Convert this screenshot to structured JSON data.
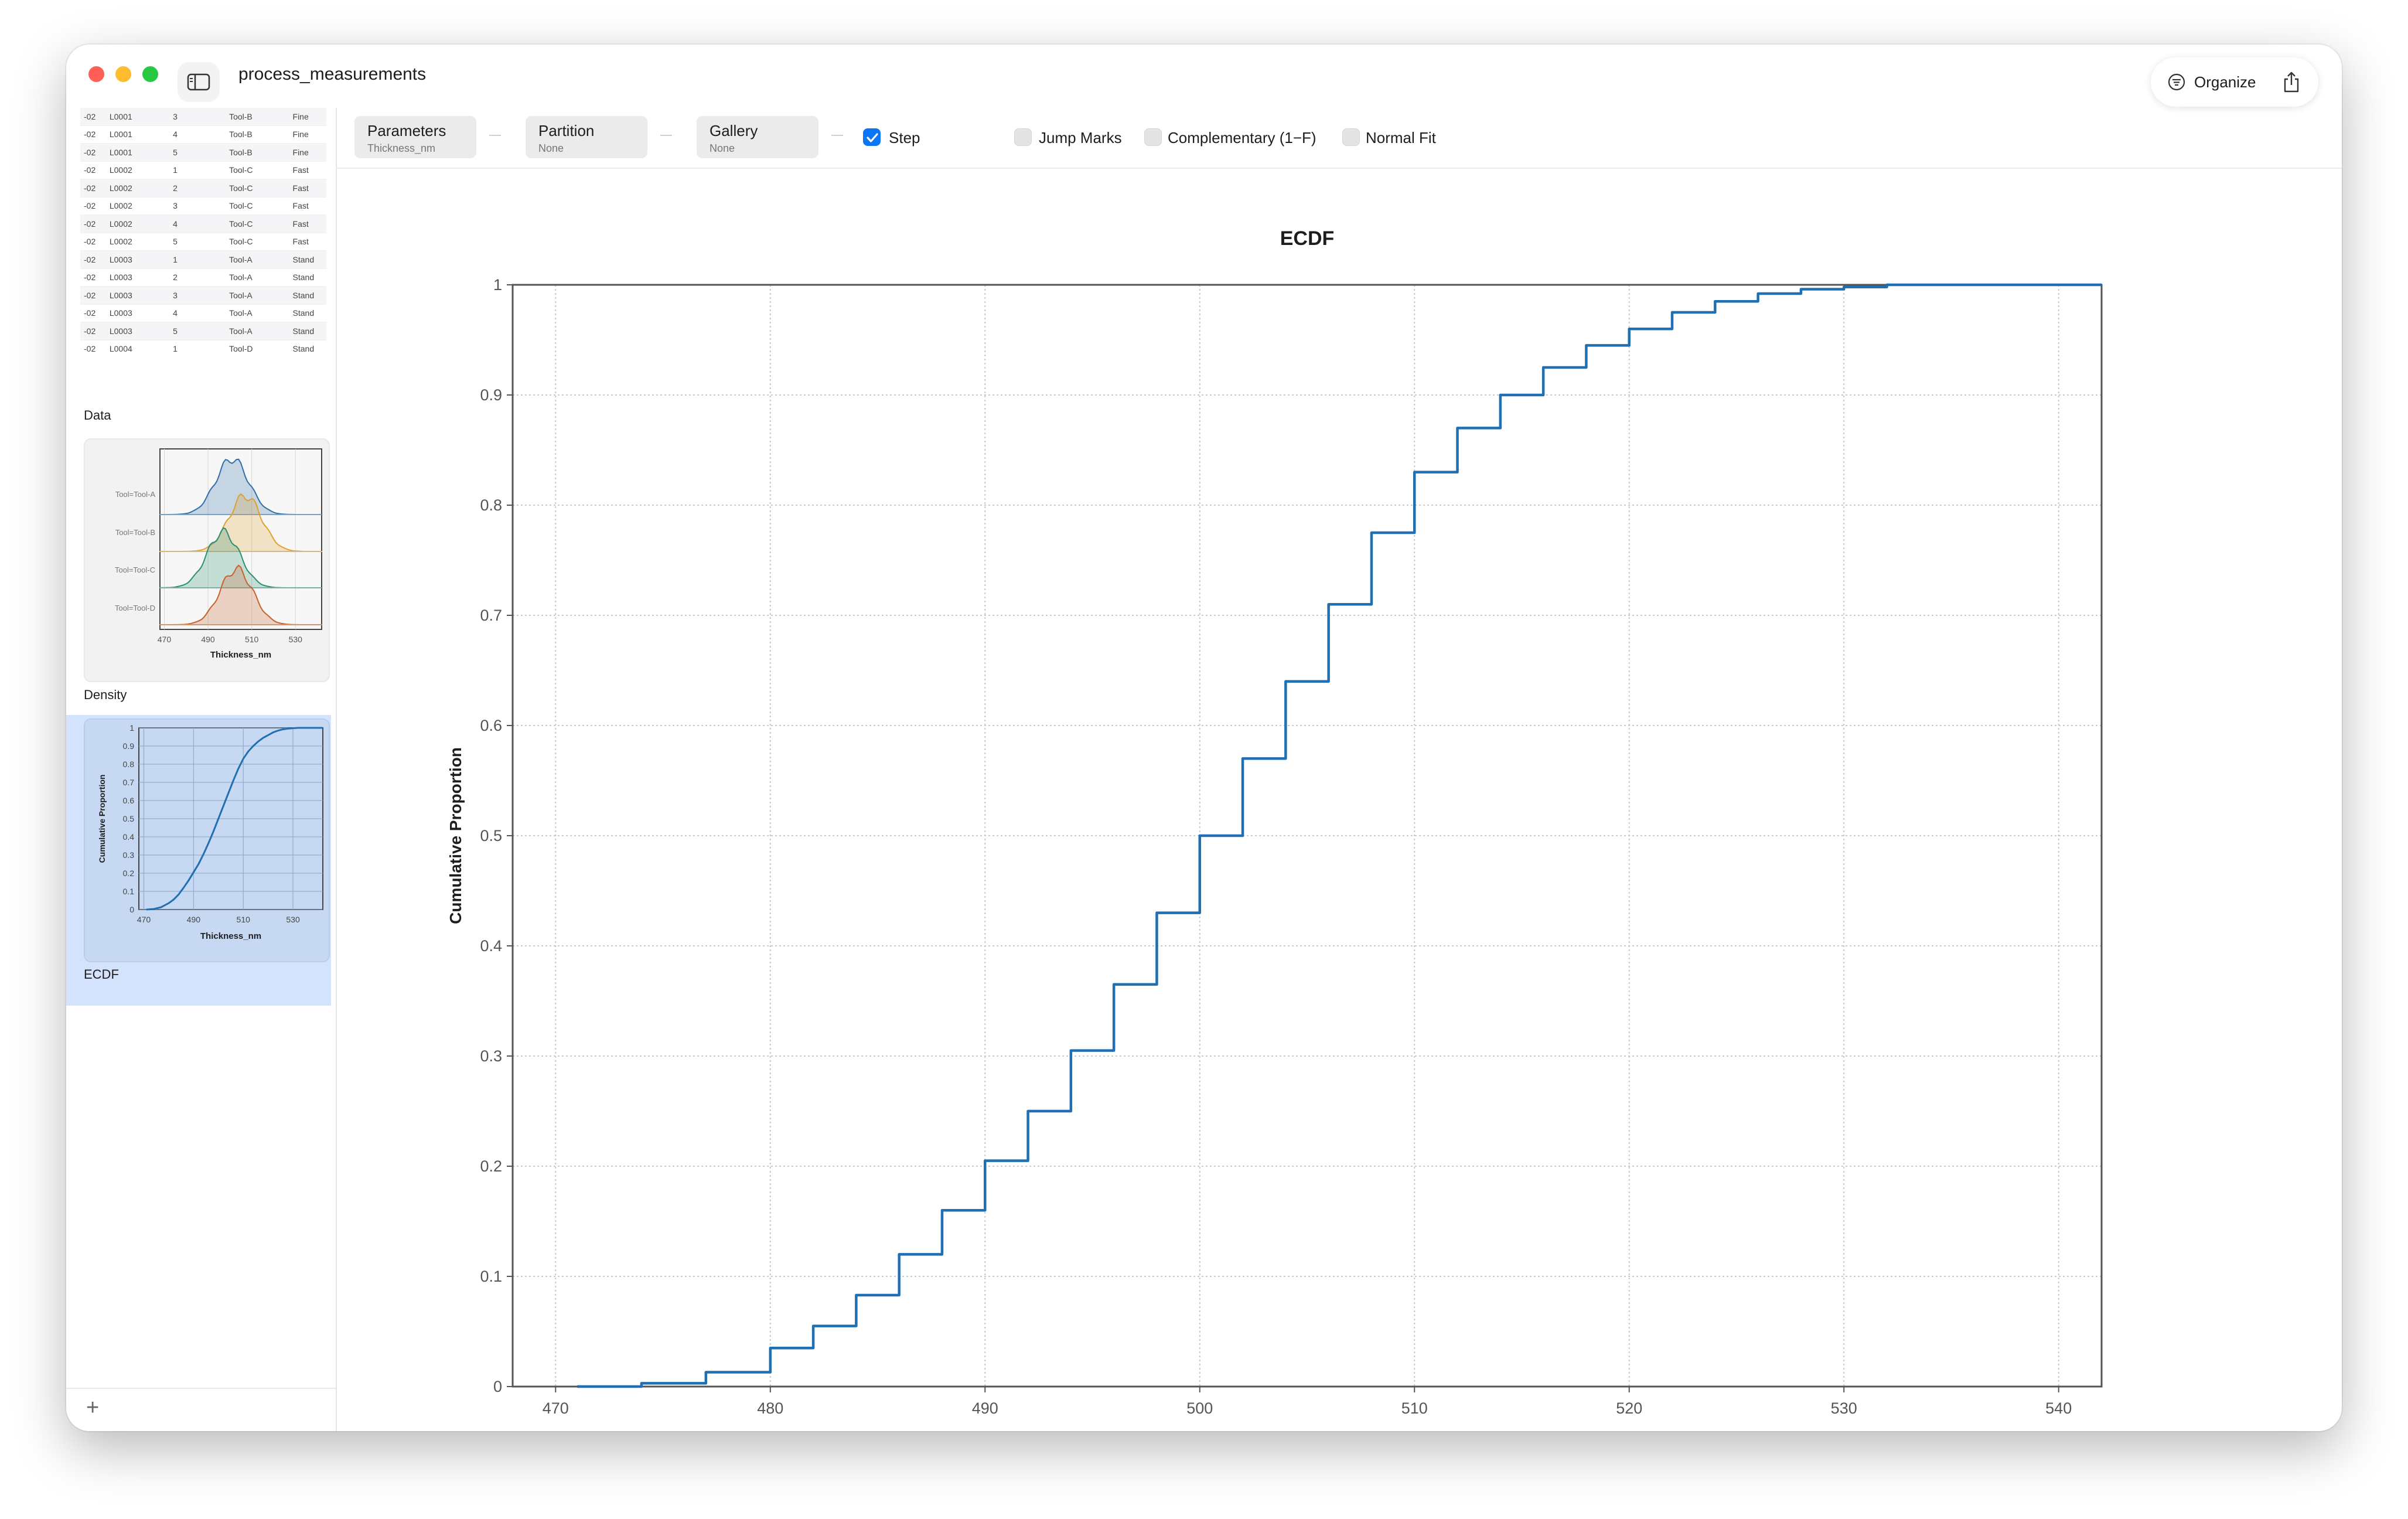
{
  "window": {
    "title": "process_measurements"
  },
  "toolbar_right": {
    "organize_label": "Organize"
  },
  "sidebar": {
    "data_rows": [
      [
        "-02",
        "L0001",
        "3",
        "Tool-B",
        "Fine"
      ],
      [
        "-02",
        "L0001",
        "4",
        "Tool-B",
        "Fine"
      ],
      [
        "-02",
        "L0001",
        "5",
        "Tool-B",
        "Fine"
      ],
      [
        "-02",
        "L0002",
        "1",
        "Tool-C",
        "Fast"
      ],
      [
        "-02",
        "L0002",
        "2",
        "Tool-C",
        "Fast"
      ],
      [
        "-02",
        "L0002",
        "3",
        "Tool-C",
        "Fast"
      ],
      [
        "-02",
        "L0002",
        "4",
        "Tool-C",
        "Fast"
      ],
      [
        "-02",
        "L0002",
        "5",
        "Tool-C",
        "Fast"
      ],
      [
        "-02",
        "L0003",
        "1",
        "Tool-A",
        "Stand"
      ],
      [
        "-02",
        "L0003",
        "2",
        "Tool-A",
        "Stand"
      ],
      [
        "-02",
        "L0003",
        "3",
        "Tool-A",
        "Stand"
      ],
      [
        "-02",
        "L0003",
        "4",
        "Tool-A",
        "Stand"
      ],
      [
        "-02",
        "L0003",
        "5",
        "Tool-A",
        "Stand"
      ],
      [
        "-02",
        "L0004",
        "1",
        "Tool-D",
        "Stand"
      ]
    ],
    "items": [
      {
        "label": "Data"
      },
      {
        "label": "Density"
      },
      {
        "label": "ECDF"
      }
    ],
    "density_thumb": {
      "row_labels": [
        "Tool=Tool-A",
        "Tool=Tool-B",
        "Tool=Tool-C",
        "Tool=Tool-D"
      ],
      "x_ticks": [
        "470",
        "490",
        "510",
        "530"
      ],
      "xlabel": "Thickness_nm",
      "colors": [
        "#2f6fa7",
        "#e0a030",
        "#2a9070",
        "#c8602a"
      ]
    },
    "ecdf_thumb": {
      "y_ticks": [
        "0",
        "0.1",
        "0.2",
        "0.3",
        "0.4",
        "0.5",
        "0.6",
        "0.7",
        "0.8",
        "0.9",
        "1"
      ],
      "x_ticks": [
        "470",
        "490",
        "510",
        "530"
      ],
      "xlabel": "Thickness_nm",
      "ylabel": "Cumulative Proportion"
    },
    "add_label": "+"
  },
  "toolbar": {
    "parameters": {
      "label": "Parameters",
      "value": "Thickness_nm"
    },
    "partition": {
      "label": "Partition",
      "value": "None"
    },
    "gallery": {
      "label": "Gallery",
      "value": "None"
    },
    "options": [
      {
        "label": "Step",
        "checked": true
      },
      {
        "label": "Jump Marks",
        "checked": false
      },
      {
        "label": "Complementary (1−F)",
        "checked": false
      },
      {
        "label": "Normal Fit",
        "checked": false
      }
    ]
  },
  "chart_data": {
    "type": "line",
    "title": "ECDF",
    "xlabel": "Thickness_nm",
    "ylabel": "Cumulative Proportion",
    "xlim": [
      468,
      542
    ],
    "ylim": [
      0,
      1
    ],
    "x_ticks": [
      470,
      480,
      490,
      500,
      510,
      520,
      530,
      540
    ],
    "y_ticks": [
      0,
      0.1,
      0.2,
      0.3,
      0.4,
      0.5,
      0.6,
      0.7,
      0.8,
      0.9,
      1
    ],
    "grid": true,
    "series": [
      {
        "color": "#1f6fb2",
        "x": [
          471,
          474,
          477,
          480,
          482,
          484,
          486,
          488,
          490,
          492,
          494,
          496,
          498,
          500,
          502,
          504,
          506,
          508,
          510,
          512,
          514,
          516,
          518,
          520,
          522,
          524,
          526,
          528,
          530,
          532,
          534,
          536,
          538,
          540
        ],
        "y": [
          0.0,
          0.003,
          0.013,
          0.035,
          0.055,
          0.083,
          0.12,
          0.16,
          0.205,
          0.25,
          0.305,
          0.365,
          0.43,
          0.5,
          0.57,
          0.64,
          0.71,
          0.775,
          0.83,
          0.87,
          0.9,
          0.925,
          0.945,
          0.96,
          0.975,
          0.985,
          0.992,
          0.996,
          0.998,
          1.0,
          1.0,
          1.0,
          1.0,
          1.0
        ]
      }
    ]
  }
}
